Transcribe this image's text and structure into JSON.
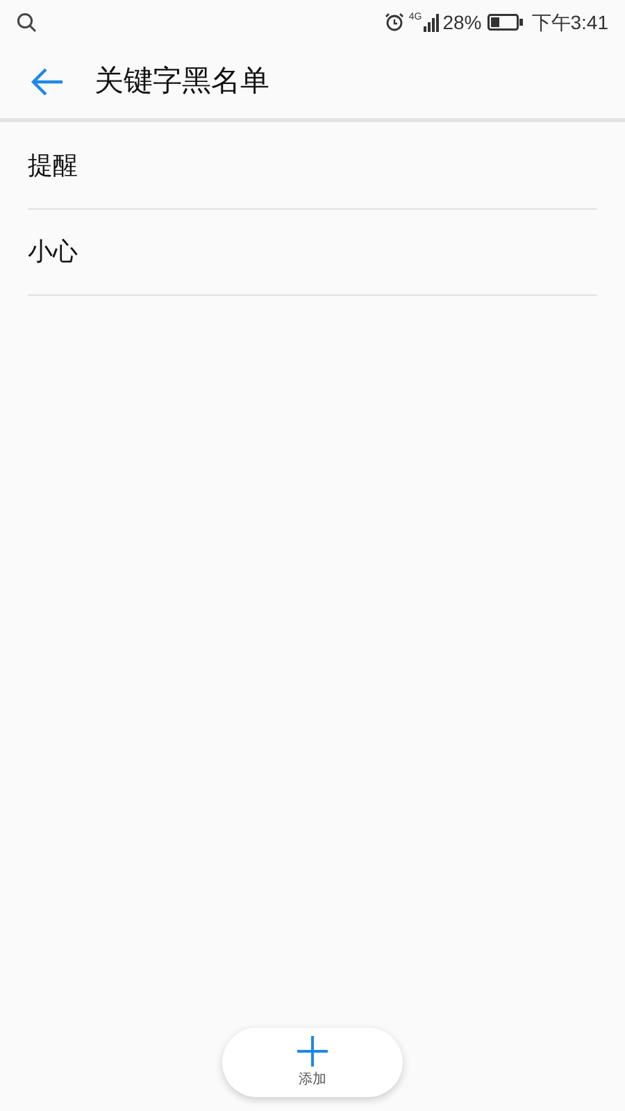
{
  "status_bar": {
    "network": "4G",
    "battery": "28%",
    "time": "下午3:41"
  },
  "header": {
    "title": "关键字黑名单"
  },
  "keywords": [
    {
      "label": "提醒"
    },
    {
      "label": "小心"
    }
  ],
  "add_button": {
    "label": "添加"
  }
}
